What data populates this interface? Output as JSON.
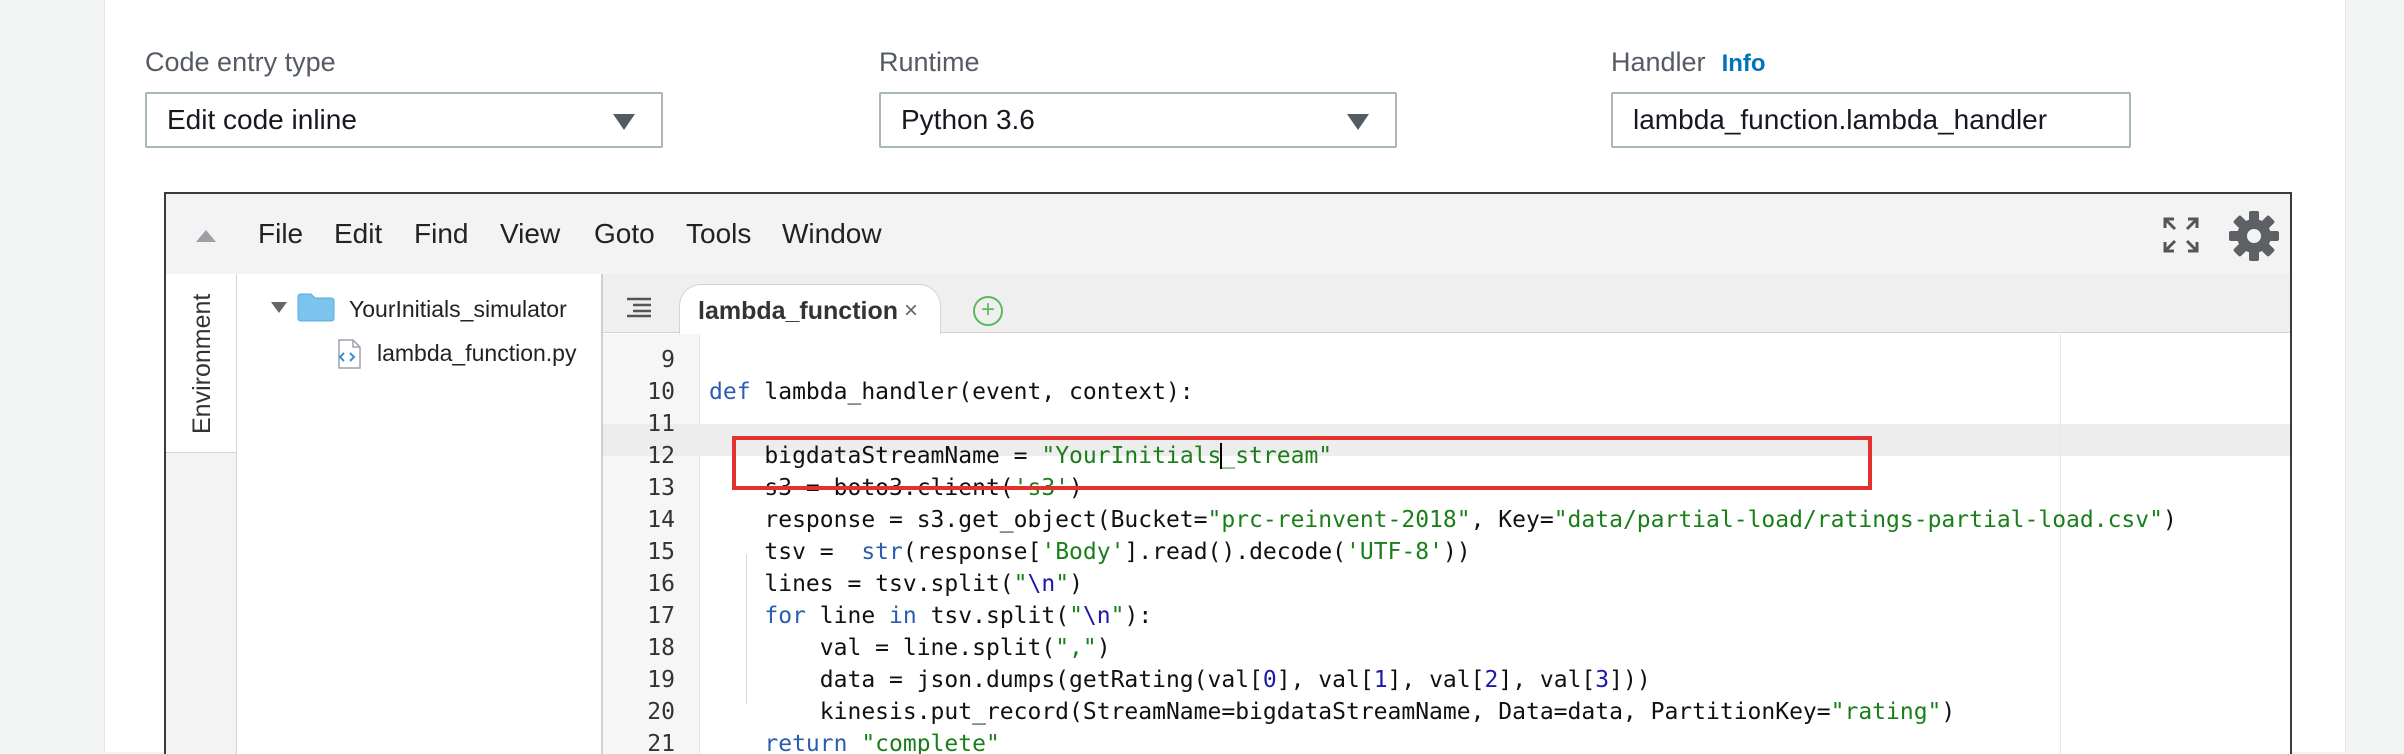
{
  "form": {
    "code_entry": {
      "label": "Code entry type",
      "value": "Edit code inline"
    },
    "runtime": {
      "label": "Runtime",
      "value": "Python 3.6"
    },
    "handler": {
      "label": "Handler",
      "info": "Info",
      "value": "lambda_function.lambda_handler"
    }
  },
  "editor": {
    "menu": [
      "File",
      "Edit",
      "Find",
      "View",
      "Goto",
      "Tools",
      "Window"
    ],
    "side_tab": "Environment",
    "tree": {
      "folder": "YourInitials_simulator",
      "file": "lambda_function.py"
    },
    "tab": {
      "name": "lambda_function",
      "close": "×",
      "add": "+"
    },
    "lines": [
      {
        "n": "9"
      },
      {
        "n": "10"
      },
      {
        "n": "11"
      },
      {
        "n": "12"
      },
      {
        "n": "13"
      },
      {
        "n": "14"
      },
      {
        "n": "15"
      },
      {
        "n": "16"
      },
      {
        "n": "17"
      },
      {
        "n": "18"
      },
      {
        "n": "19"
      },
      {
        "n": "20"
      },
      {
        "n": "21"
      }
    ],
    "code": {
      "l10": {
        "kw": "def",
        "rest": " lambda_handler(event, context):"
      },
      "l12": {
        "a": "    bigdataStreamName = ",
        "s": "\"YourInitials_stream\""
      },
      "l13": {
        "a": "    s3 = boto3.client(",
        "s": "'s3'",
        "b": ")"
      },
      "l14": {
        "a": "    response = s3.get_object(Bucket=",
        "s1": "\"prc-reinvent-2018\"",
        "b": ", Key=",
        "s2": "\"data/partial-load/ratings-partial-load.csv\"",
        "c": ")"
      },
      "l15": {
        "a": "    tsv =  ",
        "f": "str",
        "b": "(response[",
        "s1": "'Body'",
        "c": "].read().decode(",
        "s2": "'UTF-8'",
        "d": "))"
      },
      "l16": {
        "a": "    lines = tsv.split(",
        "s1": "\"",
        "e": "\\n",
        "s2": "\"",
        "b": ")"
      },
      "l17": {
        "k1": "for",
        "a": " line ",
        "k2": "in",
        "b": " tsv.split(",
        "s1": "\"",
        "e": "\\n",
        "s2": "\"",
        "c": "):"
      },
      "l18": {
        "a": "        val = line.split(",
        "s": "\",\"",
        "b": ")"
      },
      "l19": {
        "a": "        data = json.dumps(getRating(val[",
        "n1": "0",
        "b": "], val[",
        "n2": "1",
        "c": "], val[",
        "n3": "2",
        "d": "], val[",
        "n4": "3",
        "e": "]))"
      },
      "l20": {
        "a": "        kinesis.put_record(StreamName=bigdataStreamName, Data=data, PartitionKey=",
        "s": "\"rating\"",
        "b": ")"
      },
      "l21": {
        "k": "return",
        "s": " \"complete\""
      }
    }
  }
}
